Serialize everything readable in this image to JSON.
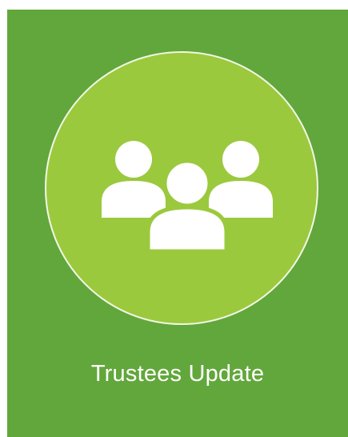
{
  "tile": {
    "title": "Trustees Update",
    "icon": "group-users-icon"
  },
  "colors": {
    "tile_background": "#62a73b",
    "circle_fill": "#9bc93d",
    "circle_border": "#f2f7e8",
    "icon_fill": "#ffffff",
    "text": "#ffffff"
  }
}
